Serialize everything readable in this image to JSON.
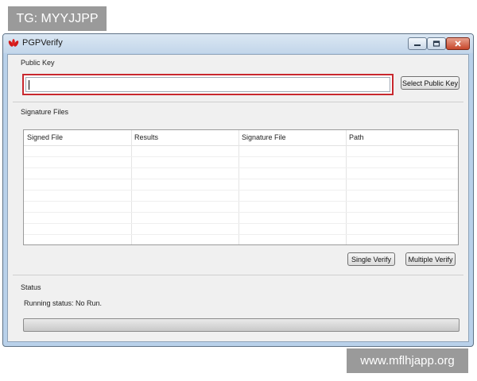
{
  "watermarks": {
    "top_left": "TG: MYYJJPP",
    "bottom_right": "www.mflhjapp.org"
  },
  "window": {
    "title": "PGPVerify",
    "app_icon": "huawei-logo-icon",
    "controls": [
      "minimize-icon",
      "maximize-icon",
      "close-icon"
    ]
  },
  "public_key": {
    "group_label": "Public Key",
    "input_value": "",
    "select_button_label": "Select Public Key",
    "highlight_color": "#c8282e"
  },
  "signature_files": {
    "group_label": "Signature Files",
    "columns": [
      "Signed File",
      "Results",
      "Signature File",
      "Path"
    ],
    "rows": [],
    "single_verify_label": "Single Verify",
    "multiple_verify_label": "Multiple Verify"
  },
  "status": {
    "group_label": "Status",
    "running_status": "Running status: No Run.",
    "progress": 0
  }
}
